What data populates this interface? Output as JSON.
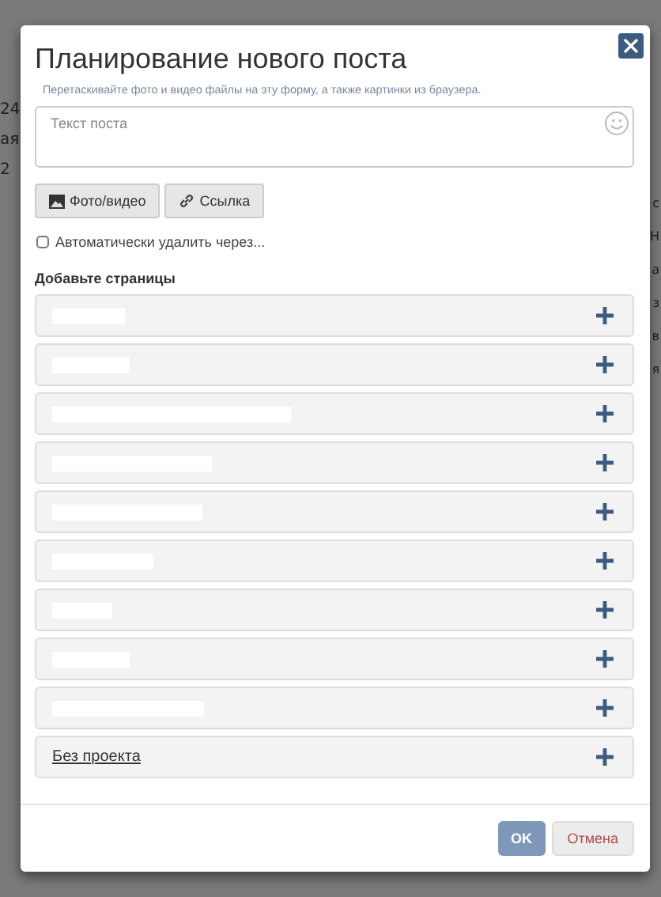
{
  "background": {
    "left_fragments": [
      "24",
      "ая",
      "2"
    ],
    "right_fragments": [
      "с",
      "Н",
      "а",
      "з",
      "в",
      "я"
    ]
  },
  "dialog": {
    "title": "Планирование нового поста",
    "hint": "Перетаскивайте фото и видео файлы на эту форму, а также картинки из браузера.",
    "post_text": {
      "placeholder": "Текст поста"
    },
    "attach_buttons": [
      "Фото/видео",
      "Ссылка"
    ],
    "auto_delete": {
      "label": "Автоматически удалить через...",
      "checked": false
    },
    "pages_heading": "Добавьте страницы",
    "pages": [
      {
        "kind": "redacted"
      },
      {
        "kind": "redacted"
      },
      {
        "kind": "redacted"
      },
      {
        "kind": "redacted"
      },
      {
        "kind": "redacted"
      },
      {
        "kind": "redacted"
      },
      {
        "kind": "redacted"
      },
      {
        "kind": "redacted"
      },
      {
        "kind": "redacted"
      },
      {
        "kind": "link",
        "name": "Без проекта"
      }
    ],
    "buttons": {
      "ok": "OK",
      "cancel": "Отмена"
    }
  }
}
